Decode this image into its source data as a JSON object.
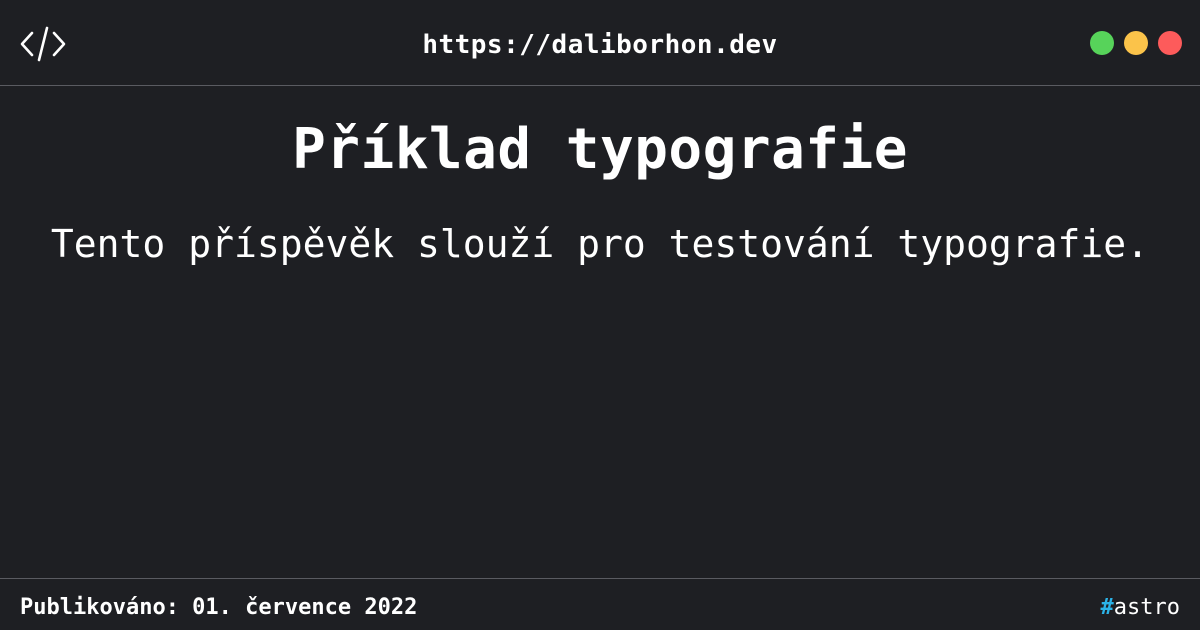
{
  "header": {
    "url": "https://daliborhon.dev",
    "code_icon": "code-brackets-icon",
    "window_controls": [
      {
        "name": "green",
        "color": "#57d35a"
      },
      {
        "name": "yellow",
        "color": "#fbc34a"
      },
      {
        "name": "red",
        "color": "#fd5b5b"
      }
    ]
  },
  "main": {
    "title": "Příklad typografie",
    "description": "Tento příspěvěk slouží pro testování typografie."
  },
  "footer": {
    "published": "Publikováno: 01. července 2022",
    "tag_hash": "#",
    "tag_name": "astro"
  },
  "colors": {
    "background": "#1e1f23",
    "text": "#ffffff",
    "divider": "#5a5b61",
    "tag_accent": "#2bb3e8"
  }
}
